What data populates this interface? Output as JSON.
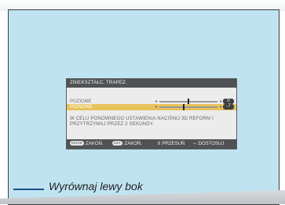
{
  "osd": {
    "title": "ZNIEKSZTAŁC. TRAPEZ.",
    "rows": [
      {
        "label": "POZIOME",
        "value": "0",
        "level": 0.5,
        "selected": false
      },
      {
        "label": "PIONOWE",
        "value": "-7",
        "level": 0.42,
        "selected": true
      }
    ],
    "info_line1": "W CELU PONOWNEGO USTAWIENIA NACIŚNIJ 3D REFORM I",
    "info_line2": "PRZYTRZYMAJ PRZEZ 2 SEKUNDY.",
    "footer": {
      "enter_key": "ENTER",
      "enter_label": ":ZAKOŃ.",
      "exit_key": "EXIT",
      "exit_label": ":ZAKOŃ.",
      "move_label": "⇕:PRZESUŃ",
      "adjust_label": "⇔:DOSTOSUJ"
    }
  },
  "callout": {
    "text": "Wyrównaj lewy bok"
  },
  "colors": {
    "screen_bg": "#bfe3f1",
    "osd_bg": "#ececec",
    "osd_dark": "#505254",
    "selected_row": "#e8c35a",
    "callout_line": "#1a4f8a"
  },
  "icons": [
    "slider-left-arrow-icon",
    "slider-right-arrow-icon",
    "up-down-arrows-icon",
    "left-right-arrows-icon"
  ]
}
